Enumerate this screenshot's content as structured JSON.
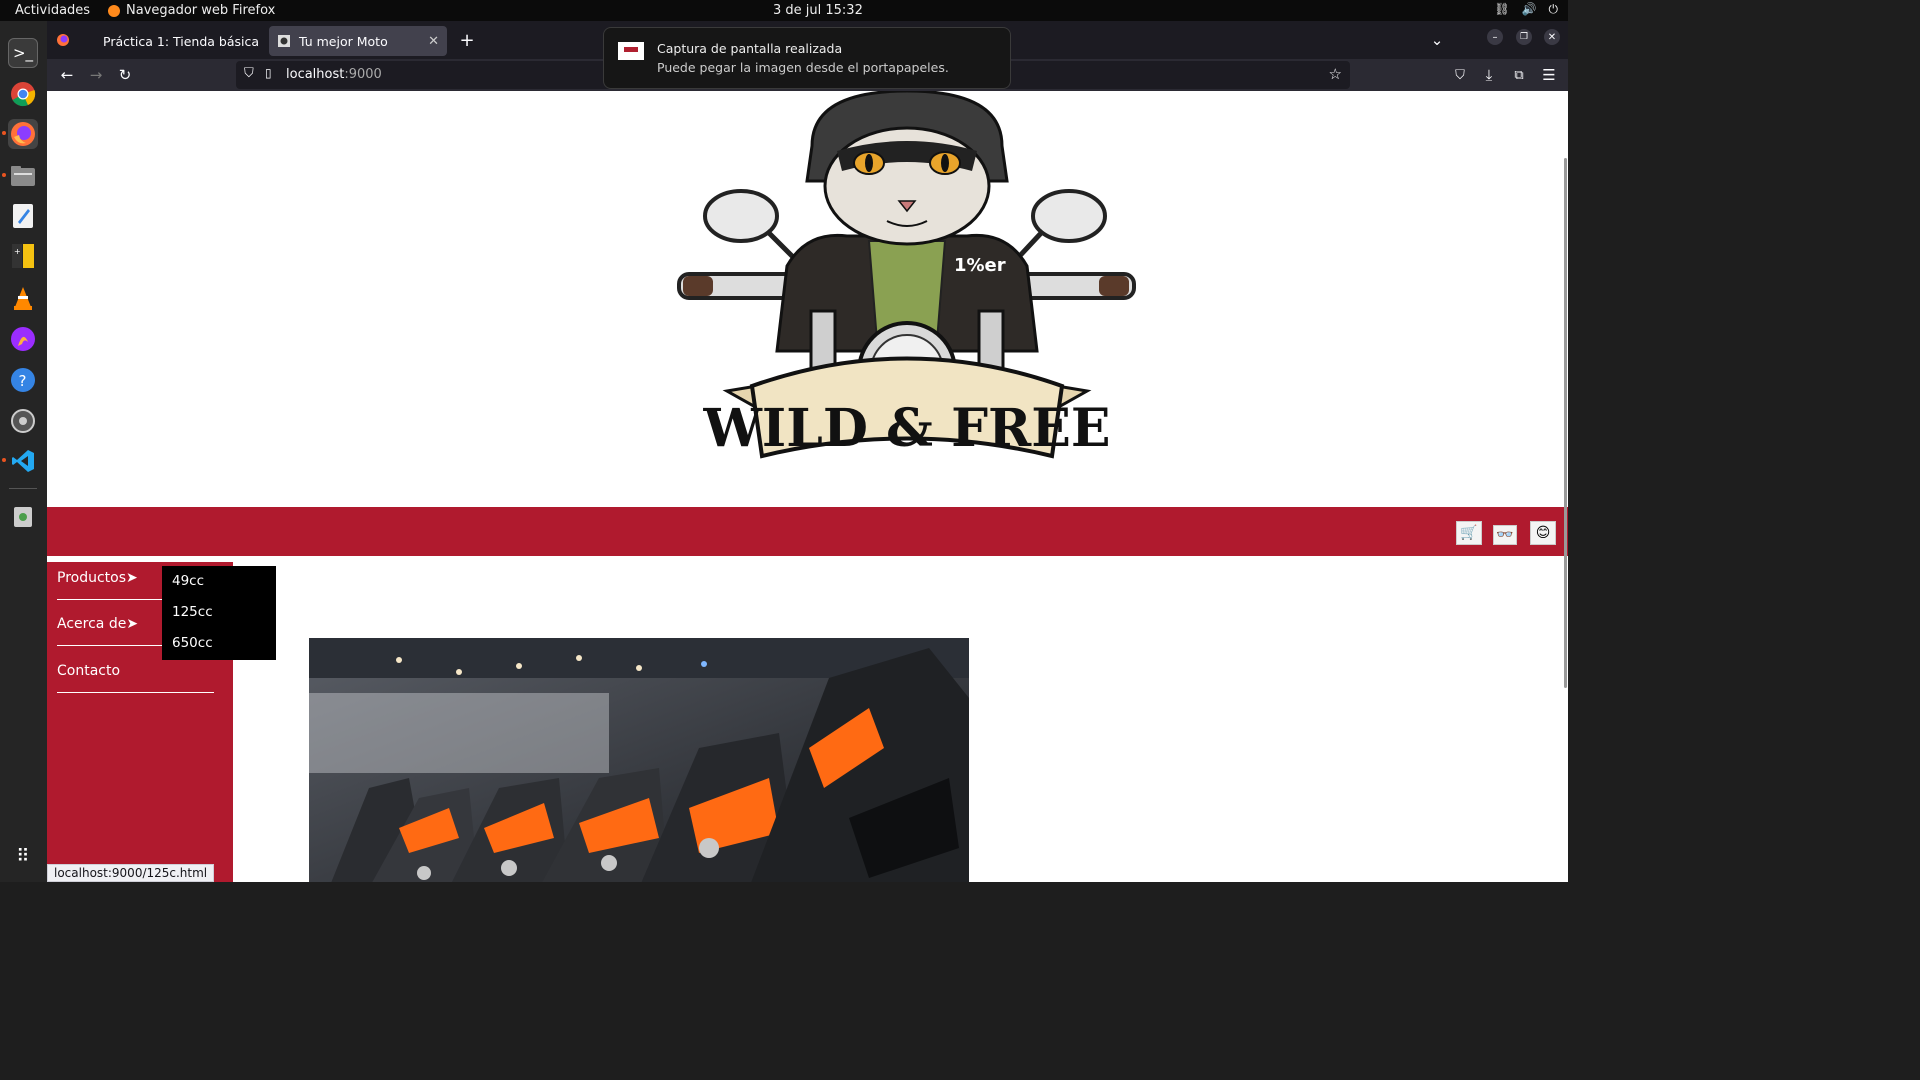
{
  "topbar": {
    "activities": "Actividades",
    "app_name": "Navegador web Firefox",
    "clock": "3 de jul  15:32"
  },
  "dock": {
    "apps": [
      "terminal-icon",
      "chrome-icon",
      "firefox-icon",
      "files-icon",
      "text-editor-icon",
      "calculator-icon",
      "vlc-icon",
      "firefox-dev-icon",
      "help-icon",
      "settings-icon",
      "vscode-icon",
      "trash-icon",
      "app-grid-icon"
    ]
  },
  "browser": {
    "tabs": [
      {
        "label": "Práctica 1: Tienda básica",
        "icon": "github-icon",
        "selected": false
      },
      {
        "label": "Tu mejor Moto",
        "icon": "page-icon",
        "selected": true
      }
    ],
    "url_host": "localhost",
    "url_port": ":9000"
  },
  "notification": {
    "title": "Captura de pantalla realizada",
    "message": "Puede pegar la imagen desde el portapapeles."
  },
  "page": {
    "hero_banner_text": "WILD & FREE",
    "hero_badge_text": "1%er",
    "header_icons": [
      "cart-icon",
      "user-icon",
      "smiley-icon"
    ],
    "menu": [
      {
        "label": "Productos➤"
      },
      {
        "label": "Acerca de➤"
      },
      {
        "label": "Contacto"
      }
    ],
    "submenu": [
      "49cc",
      "125cc",
      "650cc"
    ],
    "status_url": "localhost:9000/125c.html"
  },
  "colors": {
    "brand_red": "#b01a2e",
    "banner_cream": "#f1e4c3"
  }
}
